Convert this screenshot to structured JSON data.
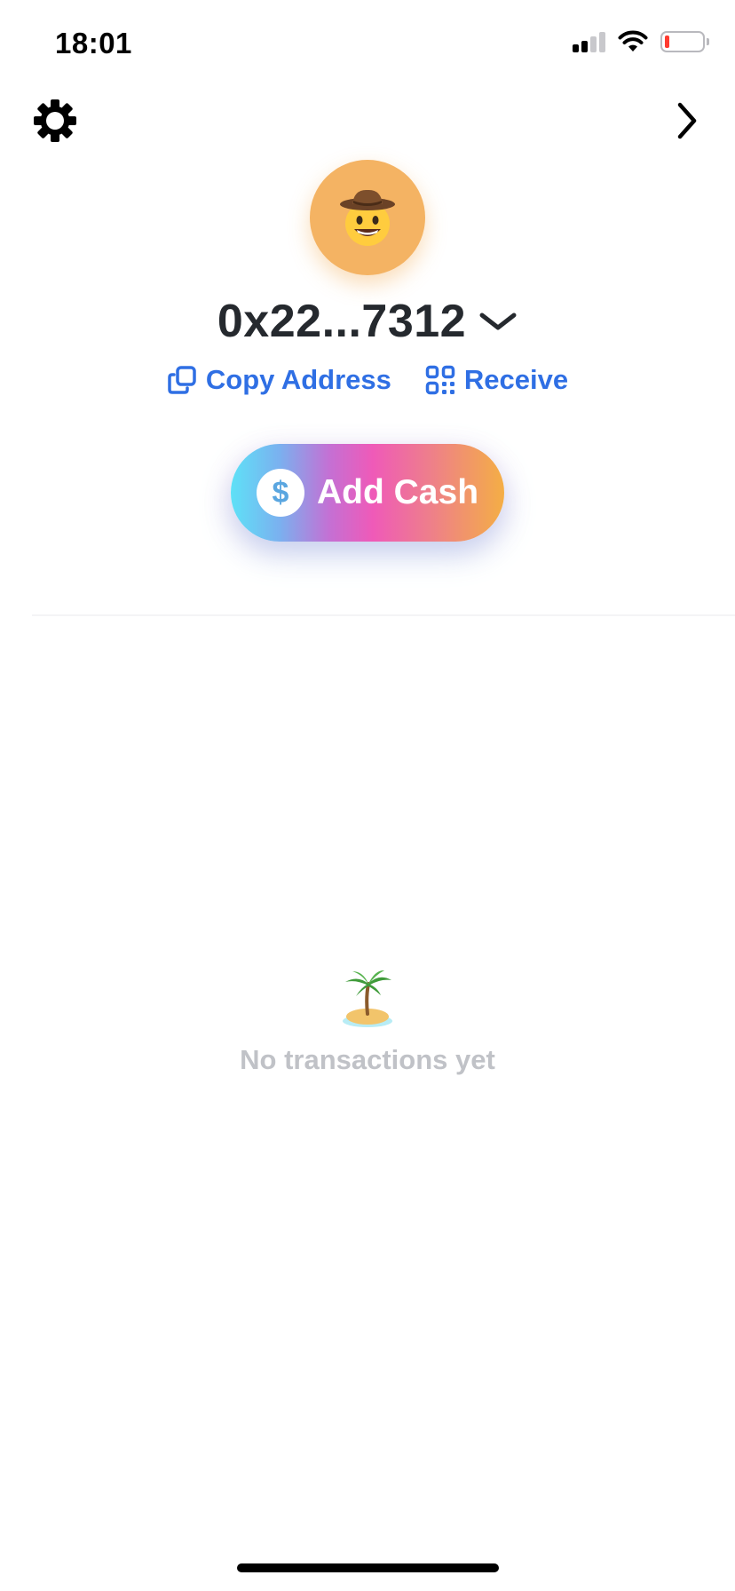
{
  "status_bar": {
    "time": "18:01",
    "battery_level": 0.12,
    "battery_color": "#ff3b30"
  },
  "nav": {
    "settings_icon": "gear-icon",
    "forward_icon": "chevron-right-icon"
  },
  "profile": {
    "avatar_emoji": "🤠",
    "avatar_color": "#f4b363",
    "address": "0x22...7312",
    "address_menu_icon": "chevron-down-icon"
  },
  "actions": {
    "copy_label": "Copy Address",
    "receive_label": "Receive",
    "accent_color": "#2f6fe4"
  },
  "add_cash": {
    "icon_symbol": "$",
    "label": "Add Cash"
  },
  "transactions": {
    "empty_emoji": "🏝",
    "empty_label": "No transactions yet"
  }
}
